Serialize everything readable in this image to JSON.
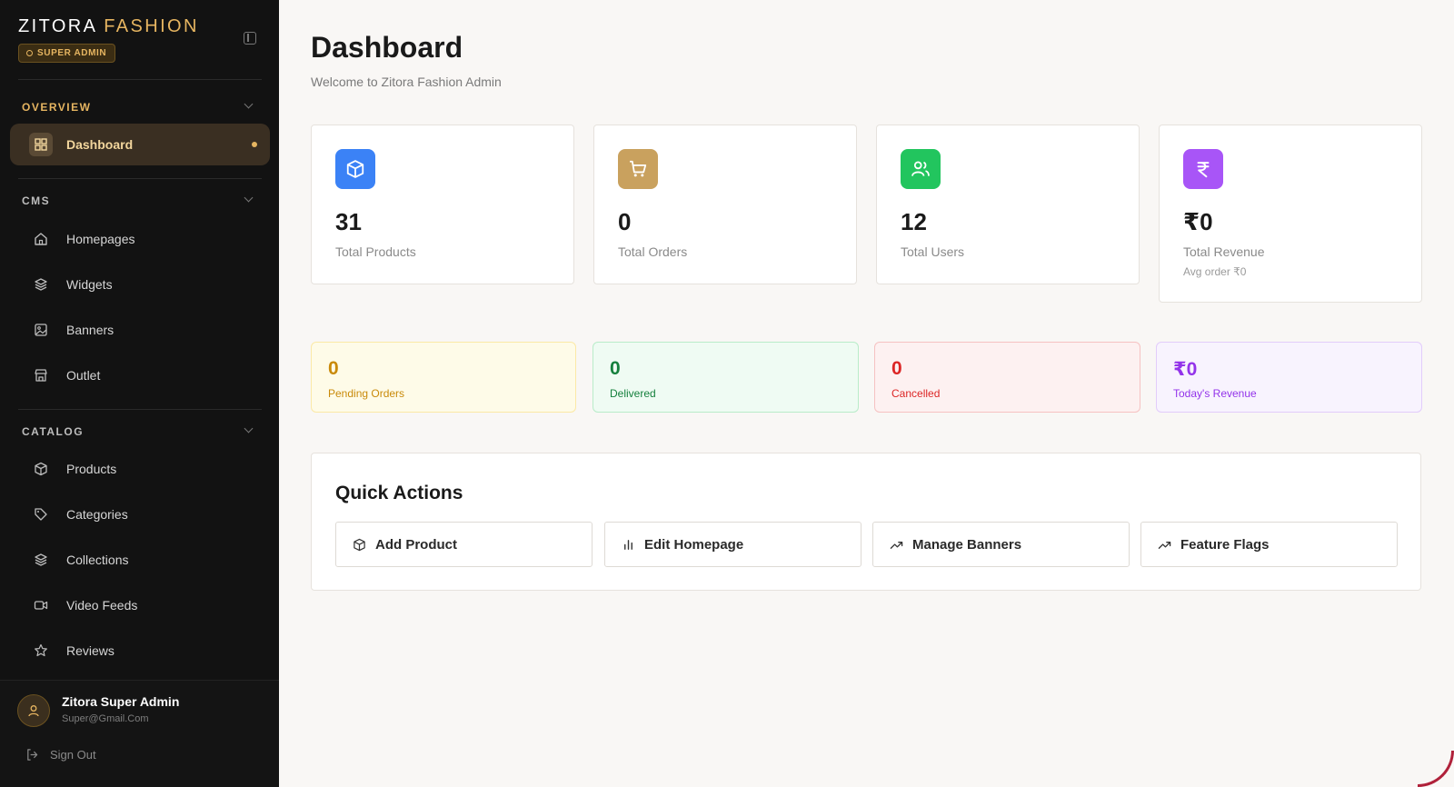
{
  "sidebar": {
    "brand_primary": "ZITORA",
    "brand_accent": "FASHION",
    "role_badge": "SUPER ADMIN",
    "sections": {
      "overview": {
        "title": "OVERVIEW"
      },
      "cms": {
        "title": "CMS"
      },
      "catalog": {
        "title": "CATALOG"
      }
    },
    "items": {
      "dashboard": "Dashboard",
      "homepages": "Homepages",
      "widgets": "Widgets",
      "banners": "Banners",
      "outlet": "Outlet",
      "products": "Products",
      "categories": "Categories",
      "collections": "Collections",
      "video_feeds": "Video Feeds",
      "reviews": "Reviews"
    },
    "user": {
      "name": "Zitora Super Admin",
      "email": "Super@Gmail.Com"
    },
    "sign_out": "Sign Out"
  },
  "main": {
    "title": "Dashboard",
    "subtitle": "Welcome to Zitora Fashion Admin",
    "stats": {
      "products": {
        "value": "31",
        "label": "Total Products",
        "icon": "box-icon",
        "color": "#3b82f6"
      },
      "orders": {
        "value": "0",
        "label": "Total Orders",
        "icon": "cart-icon",
        "color": "#c9a15e"
      },
      "users": {
        "value": "12",
        "label": "Total Users",
        "icon": "users-icon",
        "color": "#22c55e"
      },
      "revenue": {
        "value": "₹0",
        "label": "Total Revenue",
        "sub": "Avg order ₹0",
        "icon": "rupee-icon",
        "color": "#a855f7"
      }
    },
    "status": {
      "pending": {
        "value": "0",
        "label": "Pending Orders"
      },
      "delivered": {
        "value": "0",
        "label": "Delivered"
      },
      "cancelled": {
        "value": "0",
        "label": "Cancelled"
      },
      "today_revenue": {
        "value": "₹0",
        "label": "Today's Revenue"
      }
    },
    "quick_actions": {
      "title": "Quick Actions",
      "add_product": "Add Product",
      "edit_homepage": "Edit Homepage",
      "manage_banners": "Manage Banners",
      "feature_flags": "Feature Flags"
    }
  },
  "colors": {
    "accent_gold": "#e6b561",
    "sidebar_bg": "#121212",
    "page_bg": "#f9f7f5"
  }
}
